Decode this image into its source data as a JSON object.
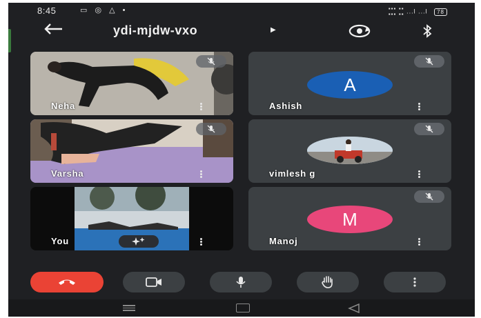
{
  "status_bar": {
    "time": "8:45",
    "left_icons": [
      "notification-icon",
      "whatsapp-icon",
      "drive-icon",
      "dot-icon"
    ],
    "signal_text": "...l ...l",
    "battery": "78"
  },
  "header": {
    "meeting_code": "ydi-mjdw-vxo",
    "icons": [
      "back-icon",
      "caret-right-icon",
      "switch-camera-icon",
      "bluetooth-icon"
    ]
  },
  "participants": [
    {
      "name": "Neha",
      "type": "video",
      "muted": true
    },
    {
      "name": "Ashish",
      "type": "avatar",
      "initial": "A",
      "avatar_color": "#1a5fb4",
      "muted": true
    },
    {
      "name": "Varsha",
      "type": "video",
      "muted": true
    },
    {
      "name": "vimlesh g",
      "type": "photo",
      "muted": true
    },
    {
      "name": "You",
      "type": "video",
      "effects_icon": "sparkle-icon",
      "muted": false
    },
    {
      "name": "Manoj",
      "type": "avatar",
      "initial": "M",
      "avatar_color": "#e8477a",
      "muted": true
    }
  ],
  "controls": [
    {
      "name": "end-call",
      "icon": "hang-up-icon",
      "color": "#ea4335"
    },
    {
      "name": "camera",
      "icon": "video-camera-icon"
    },
    {
      "name": "microphone",
      "icon": "microphone-icon"
    },
    {
      "name": "raise-hand",
      "icon": "hand-icon"
    },
    {
      "name": "more-options",
      "icon": "more-vertical-icon"
    }
  ],
  "navigation": [
    "menu-icon",
    "home-icon",
    "back-triangle-icon"
  ]
}
